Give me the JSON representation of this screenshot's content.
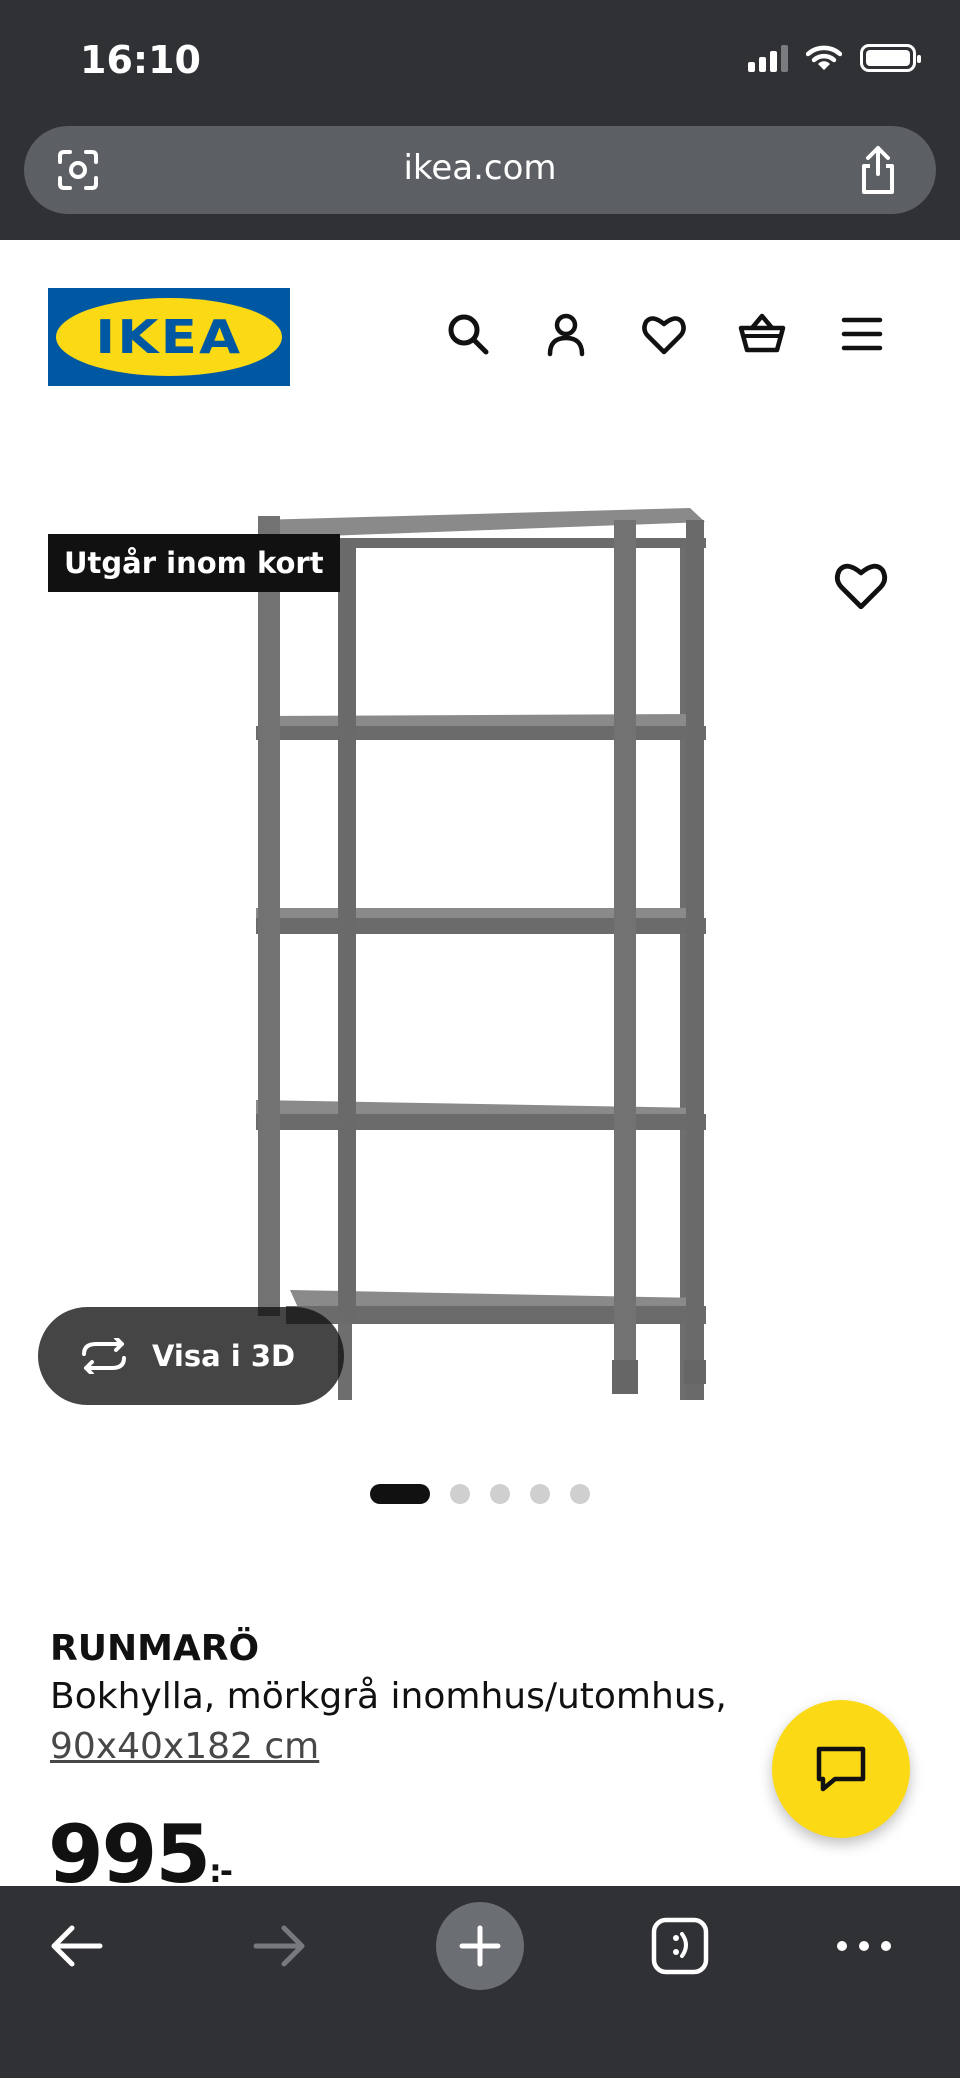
{
  "status_bar": {
    "time": "16:10"
  },
  "browser": {
    "url": "ikea.com"
  },
  "header": {
    "logo_text": "IKEA",
    "icons": [
      "search-icon",
      "account-icon",
      "heart-icon",
      "basket-icon",
      "menu-icon"
    ]
  },
  "product": {
    "badge": "Utgår inom kort",
    "view3d_label": "Visa i 3D",
    "image_count": 5,
    "active_image": 1,
    "name": "RUNMARÖ",
    "description": "Bokhylla, mörkgrå inomhus/utomhus,",
    "size": "90x40x182 cm",
    "price": "995",
    "price_suffix": ":-"
  },
  "colors": {
    "ikea_blue": "#0058a3",
    "ikea_yellow": "#fbd914",
    "chrome": "#2f3134"
  }
}
